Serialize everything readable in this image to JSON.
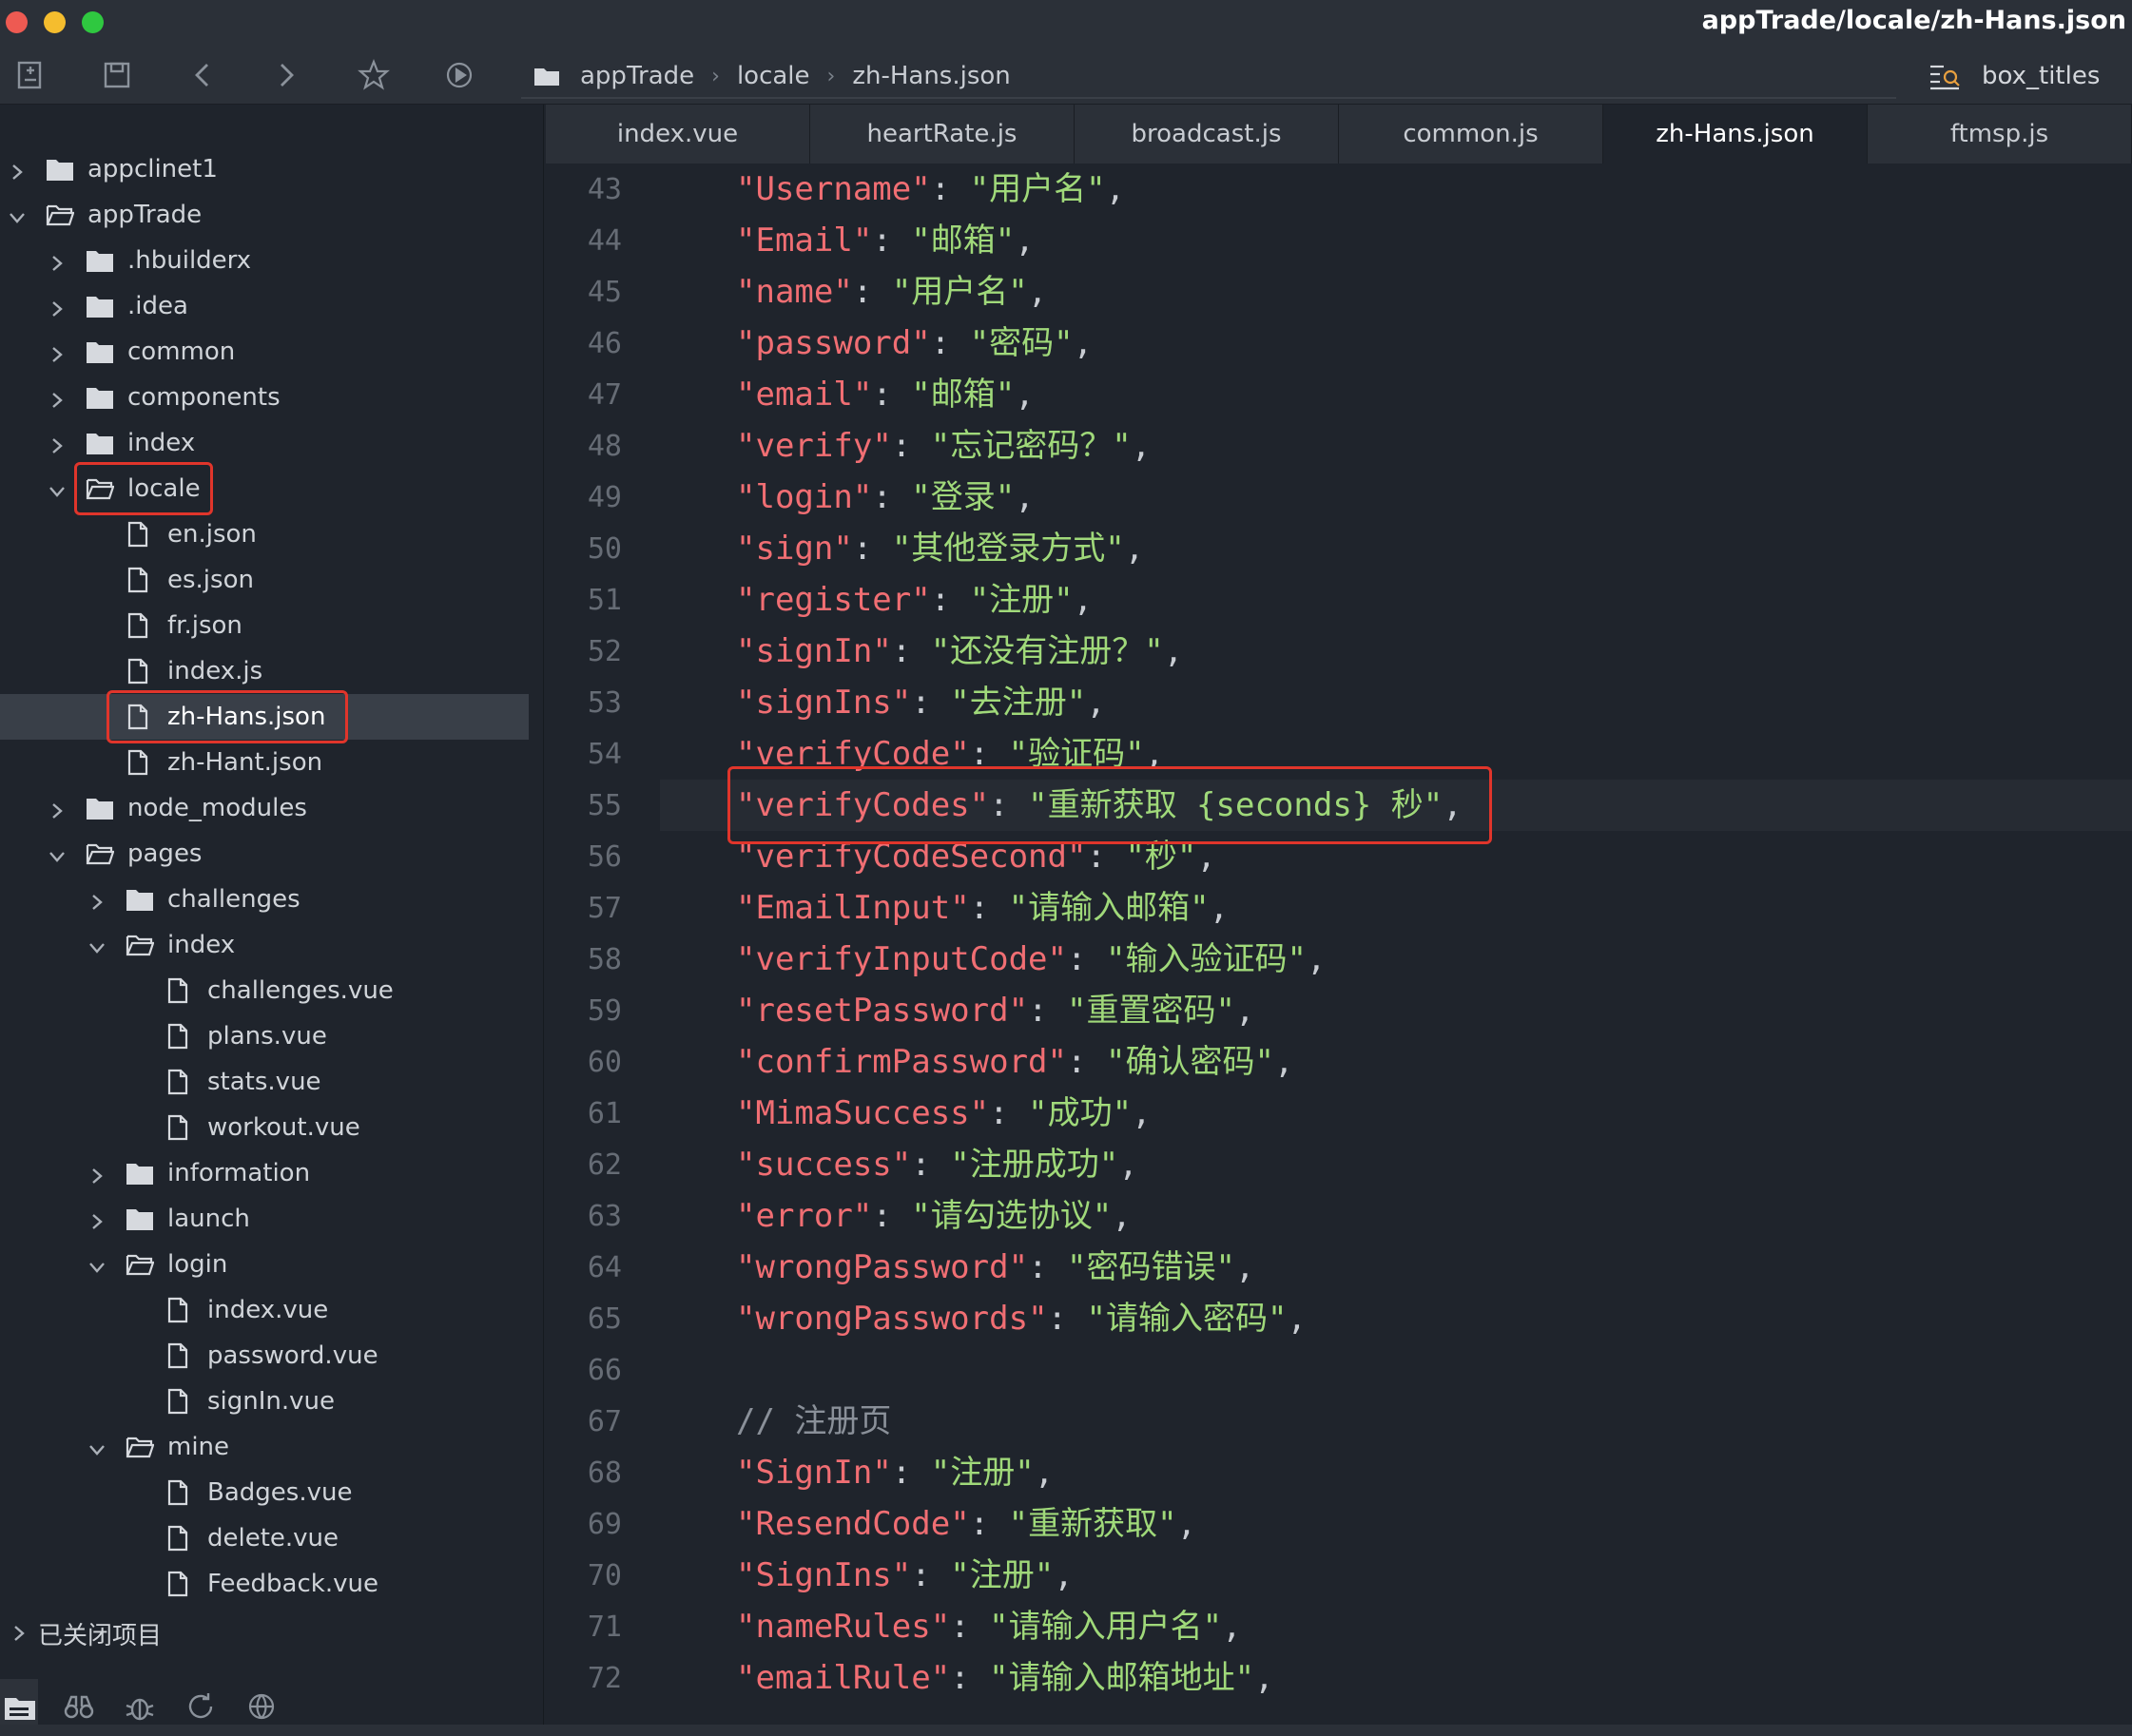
{
  "window": {
    "title": "appTrade/locale/zh-Hans.json"
  },
  "toolbar": {
    "icons": [
      "new-file-icon",
      "save-icon",
      "back-icon",
      "forward-icon",
      "star-icon",
      "run-icon"
    ],
    "breadcrumb": [
      "appTrade",
      "locale",
      "zh-Hans.json"
    ],
    "outline_label": "box_titles"
  },
  "sidebar": {
    "tree": [
      {
        "label": "appclinet1",
        "level": 0,
        "type": "folder",
        "expanded": false
      },
      {
        "label": "appTrade",
        "level": 0,
        "type": "folder",
        "expanded": true
      },
      {
        "label": ".hbuilderx",
        "level": 1,
        "type": "folder",
        "expanded": false
      },
      {
        "label": ".idea",
        "level": 1,
        "type": "folder",
        "expanded": false
      },
      {
        "label": "common",
        "level": 1,
        "type": "folder",
        "expanded": false
      },
      {
        "label": "components",
        "level": 1,
        "type": "folder",
        "expanded": false
      },
      {
        "label": "index",
        "level": 1,
        "type": "folder",
        "expanded": false
      },
      {
        "label": "locale",
        "level": 1,
        "type": "folder",
        "expanded": true,
        "highlight": true
      },
      {
        "label": "en.json",
        "level": 2,
        "type": "file"
      },
      {
        "label": "es.json",
        "level": 2,
        "type": "file"
      },
      {
        "label": "fr.json",
        "level": 2,
        "type": "file"
      },
      {
        "label": "index.js",
        "level": 2,
        "type": "file"
      },
      {
        "label": "zh-Hans.json",
        "level": 2,
        "type": "file",
        "selected": true,
        "highlight": true
      },
      {
        "label": "zh-Hant.json",
        "level": 2,
        "type": "file"
      },
      {
        "label": "node_modules",
        "level": 1,
        "type": "folder",
        "expanded": false
      },
      {
        "label": "pages",
        "level": 1,
        "type": "folder",
        "expanded": true
      },
      {
        "label": "challenges",
        "level": 2,
        "type": "folder",
        "expanded": false
      },
      {
        "label": "index",
        "level": 2,
        "type": "folder",
        "expanded": true
      },
      {
        "label": "challenges.vue",
        "level": 3,
        "type": "file"
      },
      {
        "label": "plans.vue",
        "level": 3,
        "type": "file"
      },
      {
        "label": "stats.vue",
        "level": 3,
        "type": "file"
      },
      {
        "label": "workout.vue",
        "level": 3,
        "type": "file"
      },
      {
        "label": "information",
        "level": 2,
        "type": "folder",
        "expanded": false
      },
      {
        "label": "launch",
        "level": 2,
        "type": "folder",
        "expanded": false
      },
      {
        "label": "login",
        "level": 2,
        "type": "folder",
        "expanded": true
      },
      {
        "label": "index.vue",
        "level": 3,
        "type": "file"
      },
      {
        "label": "password.vue",
        "level": 3,
        "type": "file"
      },
      {
        "label": "signIn.vue",
        "level": 3,
        "type": "file"
      },
      {
        "label": "mine",
        "level": 2,
        "type": "folder",
        "expanded": true
      },
      {
        "label": "Badges.vue",
        "level": 3,
        "type": "file"
      },
      {
        "label": "delete.vue",
        "level": 3,
        "type": "file"
      },
      {
        "label": "Feedback.vue",
        "level": 3,
        "type": "file"
      }
    ],
    "closed_projects": "已关闭项目",
    "bottom_icons": [
      "project-icon",
      "binoculars-icon",
      "bug-icon",
      "refresh-icon",
      "globe-icon"
    ]
  },
  "tabs": [
    {
      "label": "index.vue",
      "active": false
    },
    {
      "label": "heartRate.js",
      "active": false
    },
    {
      "label": "broadcast.js",
      "active": false
    },
    {
      "label": "common.js",
      "active": false
    },
    {
      "label": "zh-Hans.json",
      "active": true
    },
    {
      "label": "ftmsp.js",
      "active": false
    }
  ],
  "editor": {
    "current_line": 55,
    "highlighted_line": 55,
    "lines": [
      {
        "n": "43",
        "key": "Username",
        "value": "用户名"
      },
      {
        "n": "44",
        "key": "Email",
        "value": "邮箱"
      },
      {
        "n": "45",
        "key": "name",
        "value": "用户名"
      },
      {
        "n": "46",
        "key": "password",
        "value": "密码"
      },
      {
        "n": "47",
        "key": "email",
        "value": "邮箱"
      },
      {
        "n": "48",
        "key": "verify",
        "value": "忘记密码？"
      },
      {
        "n": "49",
        "key": "login",
        "value": "登录"
      },
      {
        "n": "50",
        "key": "sign",
        "value": "其他登录方式"
      },
      {
        "n": "51",
        "key": "register",
        "value": "注册"
      },
      {
        "n": "52",
        "key": "signIn",
        "value": "还没有注册？"
      },
      {
        "n": "53",
        "key": "signIns",
        "value": "去注册"
      },
      {
        "n": "54",
        "key": "verifyCode",
        "value": "验证码"
      },
      {
        "n": "55",
        "key": "verifyCodes",
        "value": "重新获取 {seconds} 秒"
      },
      {
        "n": "56",
        "key": "verifyCodeSecond",
        "value": "秒"
      },
      {
        "n": "57",
        "key": "EmailInput",
        "value": "请输入邮箱"
      },
      {
        "n": "58",
        "key": "verifyInputCode",
        "value": "输入验证码"
      },
      {
        "n": "59",
        "key": "resetPassword",
        "value": "重置密码"
      },
      {
        "n": "60",
        "key": "confirmPassword",
        "value": "确认密码"
      },
      {
        "n": "61",
        "key": "MimaSuccess",
        "value": "成功"
      },
      {
        "n": "62",
        "key": "success",
        "value": "注册成功"
      },
      {
        "n": "63",
        "key": "error",
        "value": "请勾选协议"
      },
      {
        "n": "64",
        "key": "wrongPassword",
        "value": "密码错误"
      },
      {
        "n": "65",
        "key": "wrongPasswords",
        "value": "请输入密码"
      },
      {
        "n": "66",
        "blank": true
      },
      {
        "n": "67",
        "comment": "// 注册页"
      },
      {
        "n": "68",
        "key": "SignIn",
        "value": "注册"
      },
      {
        "n": "69",
        "key": "ResendCode",
        "value": "重新获取"
      },
      {
        "n": "70",
        "key": "SignIns",
        "value": "注册"
      },
      {
        "n": "71",
        "key": "nameRules",
        "value": "请输入用户名"
      },
      {
        "n": "72",
        "key": "emailRule",
        "value": "请输入邮箱地址"
      }
    ]
  },
  "colors": {
    "key": "#f06e73",
    "string": "#a0d97a",
    "highlight_border": "#e0352b",
    "selection_bg": "#393f48"
  }
}
